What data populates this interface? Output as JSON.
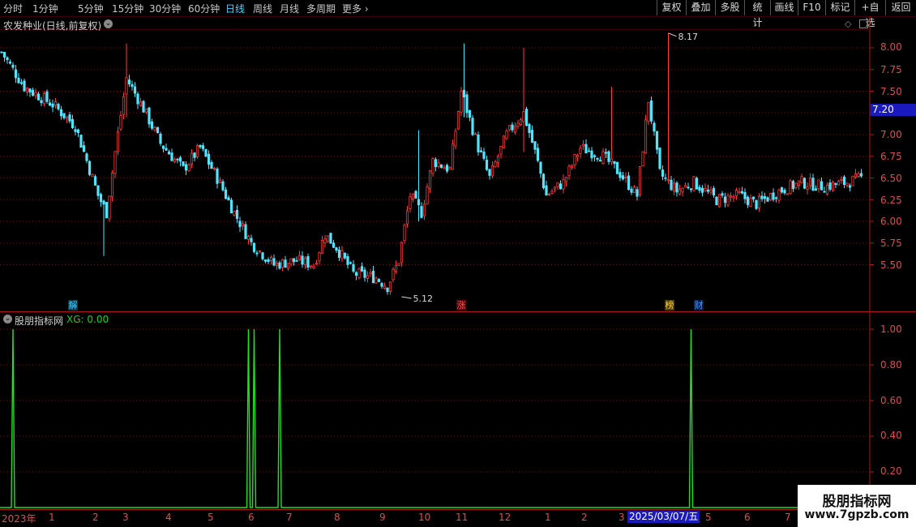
{
  "toolbar": {
    "periods": [
      "分时",
      "1分钟",
      "5分钟",
      "15分钟",
      "30分钟",
      "60分钟",
      "日线",
      "周线",
      "月线",
      "多周期",
      "更多"
    ],
    "active_period": "日线",
    "tools": [
      "复权",
      "叠加",
      "多股",
      "统计",
      "画线",
      "F10",
      "标记",
      "+自选",
      "返回"
    ]
  },
  "chart_title": "农发种业(日线,前复权)",
  "price_axis": [
    "8.00",
    "7.75",
    "7.50",
    "7.25",
    "7.00",
    "6.75",
    "6.50",
    "6.25",
    "6.00",
    "5.75",
    "5.50"
  ],
  "current_price": "7.20",
  "annotations": {
    "high": "8.17",
    "low": "5.12"
  },
  "markers": [
    {
      "label": "解",
      "color": "#40d0ff"
    },
    {
      "label": "涨",
      "color": "#ff5050"
    },
    {
      "label": "榜",
      "color": "#ffd040"
    },
    {
      "label": "财",
      "color": "#40a0ff"
    }
  ],
  "indicator": {
    "name": "股朋指标网",
    "xg": "XG: 0.00",
    "axis": [
      "1.00",
      "0.80",
      "0.60",
      "0.40",
      "0.20"
    ]
  },
  "x_ticks": [
    "2023年",
    "1",
    "2",
    "3",
    "4",
    "5",
    "6",
    "7",
    "8",
    "9",
    "10",
    "11",
    "12",
    "1",
    "2",
    "3",
    "5",
    "6",
    "7"
  ],
  "cursor_date": "2025/03/07/五",
  "watermark": {
    "title": "股朋指标网",
    "url": "www.7gpzb.com"
  },
  "chart_data": {
    "type": "candlestick",
    "title": "农发种业(日线,前复权)",
    "ylim": [
      5.1,
      8.2
    ],
    "trend": [
      {
        "i": 0,
        "p": 7.95
      },
      {
        "i": 8,
        "p": 7.55
      },
      {
        "i": 18,
        "p": 7.35
      },
      {
        "i": 26,
        "p": 7.1
      },
      {
        "i": 34,
        "p": 6.3
      },
      {
        "i": 37,
        "p": 6.1
      },
      {
        "i": 40,
        "p": 6.8
      },
      {
        "i": 44,
        "p": 7.65
      },
      {
        "i": 50,
        "p": 7.3
      },
      {
        "i": 56,
        "p": 6.9
      },
      {
        "i": 64,
        "p": 6.6
      },
      {
        "i": 70,
        "p": 6.85
      },
      {
        "i": 76,
        "p": 6.5
      },
      {
        "i": 82,
        "p": 6.1
      },
      {
        "i": 88,
        "p": 5.75
      },
      {
        "i": 96,
        "p": 5.5
      },
      {
        "i": 104,
        "p": 5.55
      },
      {
        "i": 110,
        "p": 5.5
      },
      {
        "i": 114,
        "p": 5.85
      },
      {
        "i": 118,
        "p": 5.7
      },
      {
        "i": 124,
        "p": 5.4
      },
      {
        "i": 132,
        "p": 5.35
      },
      {
        "i": 136,
        "p": 5.25
      },
      {
        "i": 140,
        "p": 5.55
      },
      {
        "i": 144,
        "p": 6.3
      },
      {
        "i": 148,
        "p": 6.1
      },
      {
        "i": 152,
        "p": 6.7
      },
      {
        "i": 158,
        "p": 6.6
      },
      {
        "i": 162,
        "p": 7.5
      },
      {
        "i": 168,
        "p": 6.85
      },
      {
        "i": 172,
        "p": 6.5
      },
      {
        "i": 178,
        "p": 7.0
      },
      {
        "i": 184,
        "p": 7.25
      },
      {
        "i": 188,
        "p": 6.8
      },
      {
        "i": 192,
        "p": 6.3
      },
      {
        "i": 198,
        "p": 6.45
      },
      {
        "i": 204,
        "p": 6.85
      },
      {
        "i": 212,
        "p": 6.75
      },
      {
        "i": 218,
        "p": 6.55
      },
      {
        "i": 224,
        "p": 6.3
      },
      {
        "i": 228,
        "p": 7.4
      },
      {
        "i": 232,
        "p": 6.55
      },
      {
        "i": 238,
        "p": 6.35
      },
      {
        "i": 244,
        "p": 6.45
      },
      {
        "i": 252,
        "p": 6.25
      },
      {
        "i": 260,
        "p": 6.3
      },
      {
        "i": 266,
        "p": 6.2
      },
      {
        "i": 274,
        "p": 6.35
      },
      {
        "i": 282,
        "p": 6.45
      },
      {
        "i": 290,
        "p": 6.4
      },
      {
        "i": 298,
        "p": 6.45
      },
      {
        "i": 303,
        "p": 6.5
      }
    ],
    "spikes": [
      {
        "i": 36,
        "high": 6.25,
        "low": 5.6
      },
      {
        "i": 44,
        "high": 8.05,
        "low": 7.2
      },
      {
        "i": 147,
        "high": 7.05,
        "low": 6.0
      },
      {
        "i": 163,
        "high": 8.05,
        "low": 7.2
      },
      {
        "i": 184,
        "high": 8.0,
        "low": 6.8
      },
      {
        "i": 215,
        "high": 7.55,
        "low": 6.75
      },
      {
        "i": 235,
        "high": 8.17,
        "low": 6.5
      }
    ],
    "indicator_series": {
      "name": "XG",
      "values": [
        0,
        1
      ],
      "spikes_at": [
        4,
        87,
        89,
        98,
        243
      ]
    }
  }
}
